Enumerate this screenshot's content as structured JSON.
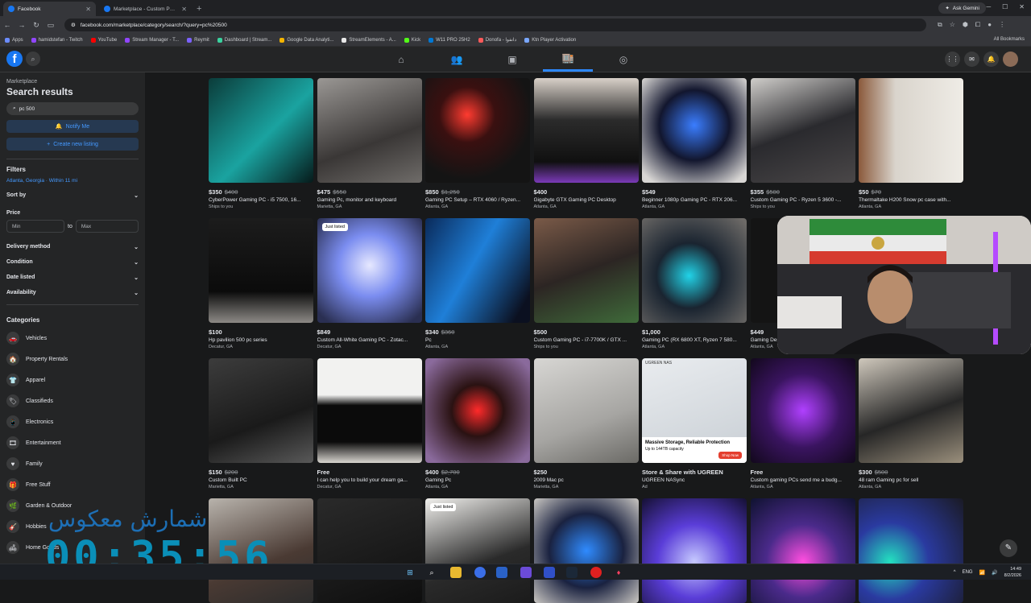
{
  "browser": {
    "tabs": [
      {
        "title": "Facebook",
        "active": true
      },
      {
        "title": "Marketplace - Custom PC (UM...",
        "active": false
      }
    ],
    "new_tab": "+",
    "ask_gemini": "Ask Gemini",
    "url": "facebook.com/marketplace/category/search/?query=pc%20500",
    "bookmarks": [
      "Apps",
      "hamidstefan - Twitch",
      "YouTube",
      "Stream Manager - T...",
      "Reymit",
      "Dashboard | Stream...",
      "Google Data Analyti...",
      "StreamElements - A...",
      "Kick",
      "W11 PRO 25H2",
      "Donofa - دانفوا",
      "Ktn Player Activation"
    ],
    "all_bookmarks": "All Bookmarks"
  },
  "fb": {
    "logo": "f"
  },
  "sidebar": {
    "crumb": "Marketplace",
    "title": "Search results",
    "query": "pc 500",
    "notify": "Notify Me",
    "create": "Create new listing",
    "filters": "Filters",
    "location": "Atlanta, Georgia · Within 11 mi",
    "sort": "Sort by",
    "price": "Price",
    "min": "Min",
    "to": "to",
    "max": "Max",
    "filter_rows": [
      "Delivery method",
      "Condition",
      "Date listed",
      "Availability"
    ],
    "categories_title": "Categories",
    "categories": [
      {
        "label": "Vehicles",
        "icon": "car-icon",
        "glyph": "🚗"
      },
      {
        "label": "Property Rentals",
        "icon": "house-icon",
        "glyph": "🏠"
      },
      {
        "label": "Apparel",
        "icon": "shirt-icon",
        "glyph": "👕"
      },
      {
        "label": "Classifieds",
        "icon": "tag-icon",
        "glyph": "🏷"
      },
      {
        "label": "Electronics",
        "icon": "phone-icon",
        "glyph": "📱"
      },
      {
        "label": "Entertainment",
        "icon": "film-icon",
        "glyph": "🎞"
      },
      {
        "label": "Family",
        "icon": "heart-icon",
        "glyph": "♥"
      },
      {
        "label": "Free Stuff",
        "icon": "gift-icon",
        "glyph": "🎁"
      },
      {
        "label": "Garden & Outdoor",
        "icon": "leaf-icon",
        "glyph": "🌿"
      },
      {
        "label": "Hobbies",
        "icon": "guitar-icon",
        "glyph": "🎸"
      },
      {
        "label": "Home Goods",
        "icon": "lamp-icon",
        "glyph": "🛋"
      }
    ]
  },
  "listings": [
    {
      "price": "$350",
      "old": "$400",
      "title": "CyberPower Gaming PC - i5 7500, 16...",
      "loc": "Ships to you",
      "bg": "linear-gradient(135deg,#0b3c3a,#1aa3a0 55%,#061a1a)"
    },
    {
      "price": "$475",
      "old": "$550",
      "title": "Gaming Pc, monitor and keyboard",
      "loc": "Marietta, GA",
      "bg": "linear-gradient(160deg,#9a9794,#3a3736 60%,#6f6c69)"
    },
    {
      "price": "$850",
      "old": "$1,250",
      "title": "Gaming PC Setup – RTX 4060 / Ryzen...",
      "loc": "Atlanta, GA",
      "bg": "radial-gradient(circle at 40% 35%,#ff3b30 0,#3a1010 30%,#141414 70%)"
    },
    {
      "price": "$400",
      "old": "",
      "title": "Gigabyte GTX Gaming PC Desktop",
      "loc": "Atlanta, GA",
      "bg": "linear-gradient(180deg,#d8d0c8 0,#2b2b2b 40%,#101010 80%,#7a3ab8 100%)"
    },
    {
      "price": "$549",
      "old": "",
      "title": "Beginner 1080p Gaming PC - RTX 206...",
      "loc": "Atlanta, GA",
      "bg": "radial-gradient(circle at 50% 45%,#3a7dff 0,#12162e 45%,#d8d6d4 90%)"
    },
    {
      "price": "$355",
      "old": "$500",
      "title": "Custom Gaming PC - Ryzen 5 3600 -...",
      "loc": "Ships to you",
      "bg": "linear-gradient(160deg,#cfcdca,#2a2a2e 50%,#4a4748)"
    },
    {
      "price": "$50",
      "old": "$70",
      "title": "Thermaltake H200 Snow pc case with...",
      "loc": "Atlanta, GA",
      "bg": "linear-gradient(90deg,#8b5a3c 0,#d9d4cc 35%,#efece6 100%)"
    },
    {
      "price": "$100",
      "old": "",
      "title": "Hp pavilion 500 pc series",
      "loc": "Decatur, GA",
      "bg": "linear-gradient(180deg,#1c1c1c,#0b0b0b 70%,#8d8a86)"
    },
    {
      "price": "$849",
      "old": "",
      "title": "Custom All-White Gaming PC - Zotac...",
      "loc": "Decatur, GA",
      "bg": "radial-gradient(circle at 50% 45%,#e6e8ff 0,#7b8df0 40%,#2a2f52 90%)",
      "badge": "Just listed"
    },
    {
      "price": "$340",
      "old": "$360",
      "title": "Pc",
      "loc": "Atlanta, GA",
      "bg": "linear-gradient(120deg,#0a2a5a,#1f7fd8 45%,#0b1020 90%)"
    },
    {
      "price": "$500",
      "old": "",
      "title": "Custom Gaming PC - i7-7700K / GTX ...",
      "loc": "Ships to you",
      "bg": "linear-gradient(160deg,#7a5a48,#2c2523 50%,#3f6b3a)"
    },
    {
      "price": "$1,000",
      "old": "",
      "title": "Gaming PC (RX 6800 XT, Ryzen 7 580...",
      "loc": "Atlanta, GA",
      "bg": "radial-gradient(circle at 45% 55%,#21d3e8 0,#1a2430 40%,#6d6a67 95%)"
    },
    {
      "price": "$449",
      "old": "",
      "title": "Gaming Des...",
      "loc": "Atlanta, GA",
      "bg": "#141414"
    },
    {
      "price": "",
      "old": "",
      "title": "",
      "loc": "",
      "bg": "#18191a"
    },
    {
      "price": "$150",
      "old": "$200",
      "title": "Custom Built PC",
      "loc": "Marietta, GA",
      "bg": "linear-gradient(160deg,#3c3c3c,#1a1a1a 60%,#595959)"
    },
    {
      "price": "Free",
      "old": "",
      "title": "I can help you to build your dream ga...",
      "loc": "Decatur, GA",
      "bg": "linear-gradient(180deg,#f2f2f0 0,#f2f2f0 35%,#0b0b0b 45%,#0b0b0b 80%,#d9d6d0 100%)"
    },
    {
      "price": "$400",
      "old": "$2,700",
      "title": "Gaming Pc",
      "loc": "Atlanta, GA",
      "bg": "radial-gradient(circle at 50% 50%,#ff2a2a 0,#2a1212 35%,#8a6a9c 90%)"
    },
    {
      "price": "$250",
      "old": "",
      "title": "2009 Mac pc",
      "loc": "Marietta, GA",
      "bg": "linear-gradient(160deg,#d7d6d3,#a6a5a2 60%,#6b6a66)"
    },
    {
      "price": "Store & Share with UGREEN",
      "old": "",
      "title": "UGREEN NASync",
      "loc": "Ad",
      "bg": "linear-gradient(160deg,#e9ecef,#c8ced4)",
      "ad": true
    },
    {
      "price": "Free",
      "old": "",
      "title": "Custom gaming PCs send me a budg...",
      "loc": "Atlanta, GA",
      "bg": "radial-gradient(circle at 50% 50%,#b040ff 0,#3a1460 50%,#12081c)"
    },
    {
      "price": "$300",
      "old": "$500",
      "title": "48 ram Gaming pc for sell",
      "loc": "Atlanta, GA",
      "bg": "linear-gradient(160deg,#cfc8bc,#262626 55%,#9a8f7c)"
    },
    {
      "price": "",
      "old": "",
      "title": "",
      "loc": "",
      "bg": "linear-gradient(160deg,#b8b3ac,#4a3a33 60%,#2c2c2c)"
    },
    {
      "price": "",
      "old": "",
      "title": "",
      "loc": "",
      "bg": "linear-gradient(160deg,#2a2a2a,#0e0e0e)"
    },
    {
      "price": "",
      "old": "",
      "title": "",
      "loc": "",
      "bg": "linear-gradient(160deg,#f0efec,#2a2a2a 60%,#1b1b1b)",
      "badge": "Just listed"
    },
    {
      "price": "",
      "old": "",
      "title": "",
      "loc": "",
      "bg": "radial-gradient(circle at 50% 50%,#2f8bff 0,#1a2240 50%,#c9c6c2)"
    },
    {
      "price": "",
      "old": "",
      "title": "",
      "loc": "",
      "bg": "radial-gradient(circle at 50% 60%,#c6c9ff 0,#5a3dd8 45%,#151033)"
    },
    {
      "price": "",
      "old": "",
      "title": "",
      "loc": "",
      "bg": "radial-gradient(circle at 50% 60%,#ff4ee0 0,#4a2a8a 45%,#0f1230)"
    },
    {
      "price": "",
      "old": "",
      "title": "",
      "loc": "",
      "bg": "radial-gradient(circle at 30% 60%,#23e0c0 0,#2a3aa0 40%,#1a1a24)"
    }
  ],
  "ad": {
    "headline": "Massive Storage, Reliable Protection",
    "sub": "Up to 144TB capacity",
    "cta": "Shop Now",
    "brand": "UGREEN NAS"
  },
  "overlay": {
    "text": "شمارش معکوس",
    "clock": "00:35:56"
  },
  "taskbar": {
    "lang": "ENG",
    "time": "14:49",
    "date": "8/2/2026"
  }
}
